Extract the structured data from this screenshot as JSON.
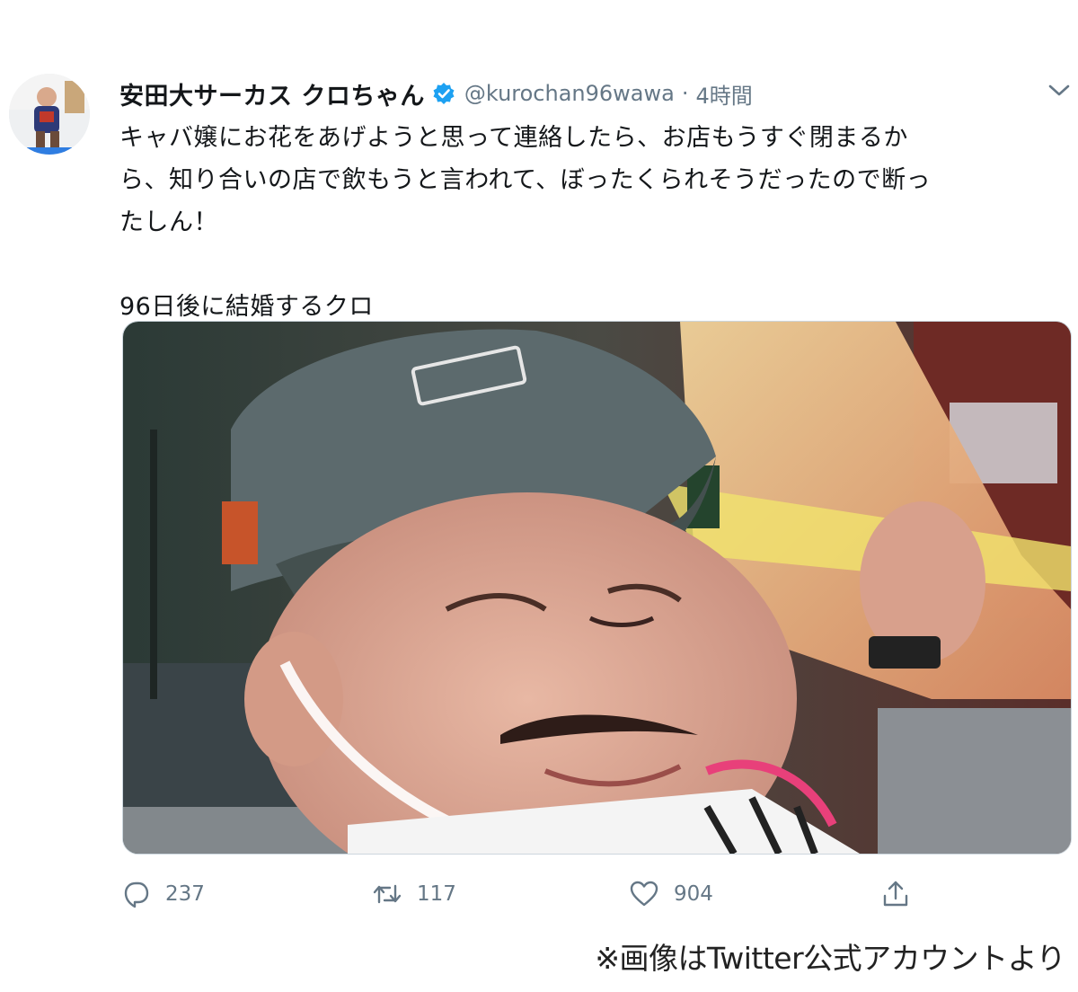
{
  "tweet": {
    "display_name": "安田大サーカス クロちゃん",
    "handle": "@kurochan96wawa",
    "separator": "·",
    "time": "4時間",
    "body_lines": [
      "キャバ嬢にお花をあげようと思って連絡したら、お店もうすぐ閉まるか",
      "ら、知り合いの店で飲もうと言われて、ぼったくられそうだったので断っ",
      "たしん！"
    ],
    "body_line2": "96日後に結婚するクロ",
    "stats": {
      "replies": "237",
      "retweets": "117",
      "likes": "904"
    }
  },
  "credit": "※画像はTwitter公式アカウントより",
  "colors": {
    "verified_blue": "#1da1f2",
    "secondary_text": "#657786",
    "primary_text": "#14171a"
  },
  "icons": {
    "verified": "verified-badge-icon",
    "caret": "chevron-down-icon",
    "reply": "reply-icon",
    "retweet": "retweet-icon",
    "like": "heart-icon",
    "share": "share-icon"
  }
}
